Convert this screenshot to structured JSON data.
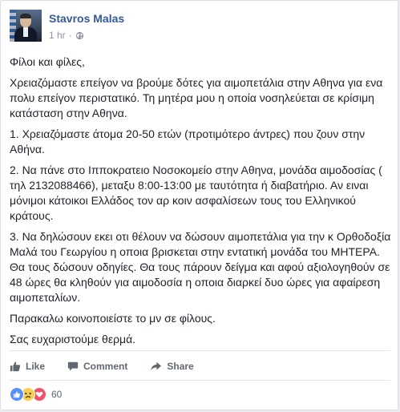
{
  "post": {
    "author": "Stavros Malas",
    "time": "1 hr",
    "separator": "·",
    "audience_icon": "globe-icon",
    "paragraphs": [
      "Φίλοι και φίλες,",
      "Χρειαζόμαστε επείγον να βρούμε δότες για αιμοπετάλια στην Αθηνα για ενα πολυ επείγον περιστατικό. Τη μητέρα μου η οποία νοσηλεύεται σε κρίσιμη κατάσταση στην Αθηνα.",
      "1. Χρειαζόμαστε άτομα 20-50 ετών (προτιμότερο άντρες) που ζουν στην Αθήνα.",
      "2. Να πάνε στο Ιπποκρατειο Νοσοκομείο στην Αθηνα, μονάδα αιμοδοσίας ( τηλ 2132088466), μεταξυ 8:00-13:00 με ταυτότητα ή διαβατήριο. Αν ειναι μόνιμοι κάτοικοι Ελλάδος τον αρ κοιν ασφαλίσεων τους του Ελληνικού κράτους.",
      "3. Να δηλώσουν εκει οτι θέλουν να δώσουν αιμοπετάλια για την κ Ορθοδοξία Μαλά του Γεωργίου η οποια βρισκεται στην εντατική μονάδα του ΜΗΤΕΡΑ. Θα τους δώσουν οδηγίες. Θα τους πάρουν δείγμα και αφού αξιολογηθούν σε 48 ώρες θα κληθούν για αιμοδοσία η οποια διαρκεί δυο ώρες για αφαίρεση αιμοπεταλίων.",
      "Παρακαλω κοινοποιείστε το μν σε φίλους.",
      "Σας ευχαριστούμε θερμά."
    ]
  },
  "actions": {
    "like": "Like",
    "comment": "Comment",
    "share": "Share"
  },
  "reactions": {
    "icons": [
      "like-icon",
      "sad-icon",
      "love-icon"
    ],
    "count": "60"
  },
  "colors": {
    "author": "#365899",
    "text": "#1d2129",
    "muted": "#90949c",
    "action": "#606770",
    "like": "#5890ff",
    "sad": "#f7d04d",
    "love": "#f25268"
  }
}
